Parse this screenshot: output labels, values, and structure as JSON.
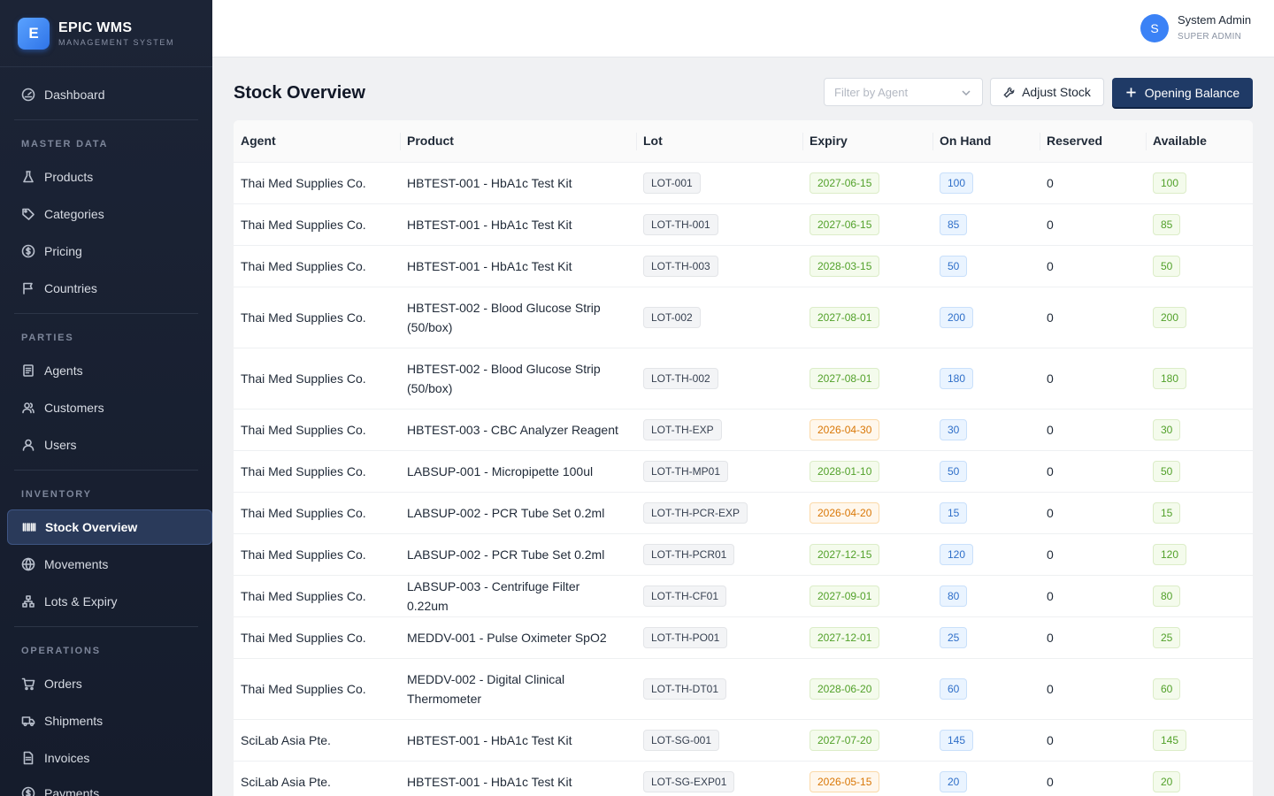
{
  "brand": {
    "logo_letter": "E",
    "name": "EPIC WMS",
    "subtitle": "MANAGEMENT SYSTEM"
  },
  "user": {
    "initial": "S",
    "name": "System Admin",
    "role": "SUPER ADMIN"
  },
  "sidebar": {
    "dashboard": "Dashboard",
    "sections": {
      "master_data": "MASTER DATA",
      "parties": "PARTIES",
      "inventory": "INVENTORY",
      "operations": "OPERATIONS"
    },
    "items": {
      "products": "Products",
      "categories": "Categories",
      "pricing": "Pricing",
      "countries": "Countries",
      "agents": "Agents",
      "customers": "Customers",
      "users": "Users",
      "stock_overview": "Stock Overview",
      "movements": "Movements",
      "lots_expiry": "Lots & Expiry",
      "orders": "Orders",
      "shipments": "Shipments",
      "invoices": "Invoices",
      "payments": "Payments"
    },
    "active": "stock_overview"
  },
  "page": {
    "title": "Stock Overview",
    "filter_placeholder": "Filter by Agent",
    "adjust_label": "Adjust Stock",
    "opening_label": "Opening Balance"
  },
  "table": {
    "columns": [
      "Agent",
      "Product",
      "Lot",
      "Expiry",
      "On Hand",
      "Reserved",
      "Available"
    ],
    "rows": [
      {
        "agent": "Thai Med Supplies Co.",
        "product": "HBTEST-001 - HbA1c Test Kit",
        "lot": "LOT-001",
        "expiry": "2027-06-15",
        "expiry_status": "ok",
        "on_hand": "100",
        "reserved": "0",
        "available": "100"
      },
      {
        "agent": "Thai Med Supplies Co.",
        "product": "HBTEST-001 - HbA1c Test Kit",
        "lot": "LOT-TH-001",
        "expiry": "2027-06-15",
        "expiry_status": "ok",
        "on_hand": "85",
        "reserved": "0",
        "available": "85"
      },
      {
        "agent": "Thai Med Supplies Co.",
        "product": "HBTEST-001 - HbA1c Test Kit",
        "lot": "LOT-TH-003",
        "expiry": "2028-03-15",
        "expiry_status": "ok",
        "on_hand": "50",
        "reserved": "0",
        "available": "50"
      },
      {
        "agent": "Thai Med Supplies Co.",
        "product": "HBTEST-002 - Blood Glucose Strip (50/box)",
        "lot": "LOT-002",
        "expiry": "2027-08-01",
        "expiry_status": "ok",
        "on_hand": "200",
        "reserved": "0",
        "available": "200"
      },
      {
        "agent": "Thai Med Supplies Co.",
        "product": "HBTEST-002 - Blood Glucose Strip (50/box)",
        "lot": "LOT-TH-002",
        "expiry": "2027-08-01",
        "expiry_status": "ok",
        "on_hand": "180",
        "reserved": "0",
        "available": "180"
      },
      {
        "agent": "Thai Med Supplies Co.",
        "product": "HBTEST-003 - CBC Analyzer Reagent",
        "lot": "LOT-TH-EXP",
        "expiry": "2026-04-30",
        "expiry_status": "warn",
        "on_hand": "30",
        "reserved": "0",
        "available": "30"
      },
      {
        "agent": "Thai Med Supplies Co.",
        "product": "LABSUP-001 - Micropipette 100ul",
        "lot": "LOT-TH-MP01",
        "expiry": "2028-01-10",
        "expiry_status": "ok",
        "on_hand": "50",
        "reserved": "0",
        "available": "50"
      },
      {
        "agent": "Thai Med Supplies Co.",
        "product": "LABSUP-002 - PCR Tube Set 0.2ml",
        "lot": "LOT-TH-PCR-EXP",
        "expiry": "2026-04-20",
        "expiry_status": "warn",
        "on_hand": "15",
        "reserved": "0",
        "available": "15"
      },
      {
        "agent": "Thai Med Supplies Co.",
        "product": "LABSUP-002 - PCR Tube Set 0.2ml",
        "lot": "LOT-TH-PCR01",
        "expiry": "2027-12-15",
        "expiry_status": "ok",
        "on_hand": "120",
        "reserved": "0",
        "available": "120"
      },
      {
        "agent": "Thai Med Supplies Co.",
        "product": "LABSUP-003 - Centrifuge Filter 0.22um",
        "lot": "LOT-TH-CF01",
        "expiry": "2027-09-01",
        "expiry_status": "ok",
        "on_hand": "80",
        "reserved": "0",
        "available": "80"
      },
      {
        "agent": "Thai Med Supplies Co.",
        "product": "MEDDV-001 - Pulse Oximeter SpO2",
        "lot": "LOT-TH-PO01",
        "expiry": "2027-12-01",
        "expiry_status": "ok",
        "on_hand": "25",
        "reserved": "0",
        "available": "25"
      },
      {
        "agent": "Thai Med Supplies Co.",
        "product": "MEDDV-002 - Digital Clinical Thermometer",
        "lot": "LOT-TH-DT01",
        "expiry": "2028-06-20",
        "expiry_status": "ok",
        "on_hand": "60",
        "reserved": "0",
        "available": "60"
      },
      {
        "agent": "SciLab Asia Pte.",
        "product": "HBTEST-001 - HbA1c Test Kit",
        "lot": "LOT-SG-001",
        "expiry": "2027-07-20",
        "expiry_status": "ok",
        "on_hand": "145",
        "reserved": "0",
        "available": "145"
      },
      {
        "agent": "SciLab Asia Pte.",
        "product": "HBTEST-001 - HbA1c Test Kit",
        "lot": "LOT-SG-EXP01",
        "expiry": "2026-05-15",
        "expiry_status": "warn",
        "on_hand": "20",
        "reserved": "0",
        "available": "20"
      }
    ]
  },
  "colors": {
    "sidebar_bg": "#1c2436",
    "primary_button": "#1f3a66",
    "expiry_ok": "#52a12a",
    "expiry_warn": "#d97706",
    "on_hand": "#2f6fc9"
  }
}
